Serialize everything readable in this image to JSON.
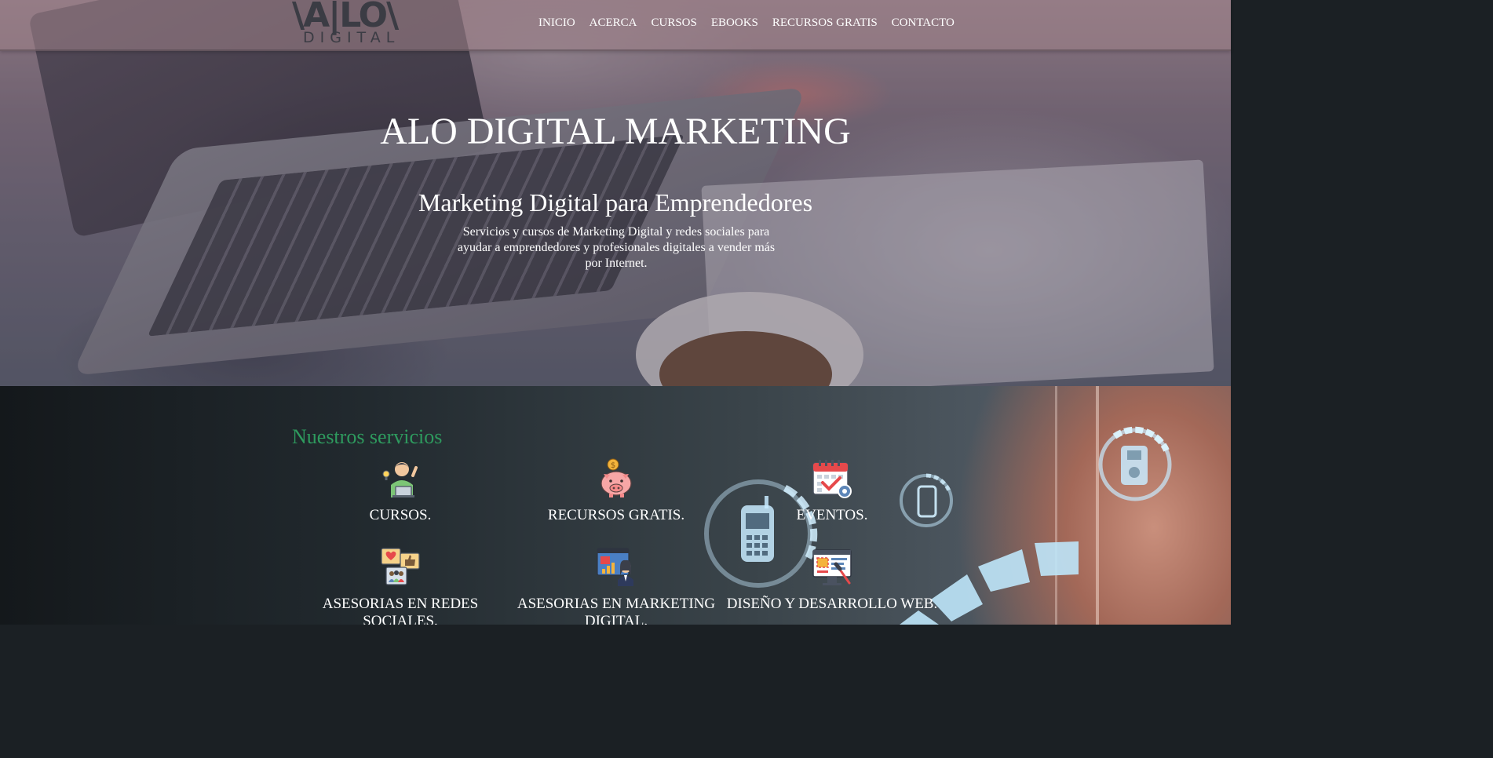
{
  "logo": {
    "mark": "\\A|LO\\",
    "sub": "DIGITAL"
  },
  "nav": {
    "items": [
      {
        "label": "INICIO"
      },
      {
        "label": "ACERCA"
      },
      {
        "label": "CURSOS"
      },
      {
        "label": "EBOOKS"
      },
      {
        "label": "RECURSOS GRATIS"
      },
      {
        "label": "CONTACTO"
      }
    ]
  },
  "hero": {
    "title": "ALO DIGITAL MARKETING",
    "subtitle": "Marketing Digital para Emprendedores",
    "description": "Servicios y cursos de Marketing Digital y redes sociales para ayudar a emprendedores y profesionales digitales a vender más por Internet."
  },
  "services": {
    "heading": "Nuestros servicios",
    "items": [
      {
        "label": "CURSOS.",
        "icon": "student-laptop-icon"
      },
      {
        "label": "RECURSOS GRATIS.",
        "icon": "piggy-bank-icon"
      },
      {
        "label": "EVENTOS.",
        "icon": "calendar-check-icon"
      },
      {
        "label": "ASESORIAS EN REDES SOCIALES.",
        "icon": "social-media-chat-icon"
      },
      {
        "label": "ASESORIAS EN MARKETING DIGITAL.",
        "icon": "analytics-presenter-icon"
      },
      {
        "label": "DISEÑO Y DESARROLLO WEB.",
        "icon": "web-design-icon"
      }
    ]
  },
  "colors": {
    "accent_green": "#2e9a5e",
    "nav_text": "#ffffff",
    "logo": "#3b3c44"
  }
}
